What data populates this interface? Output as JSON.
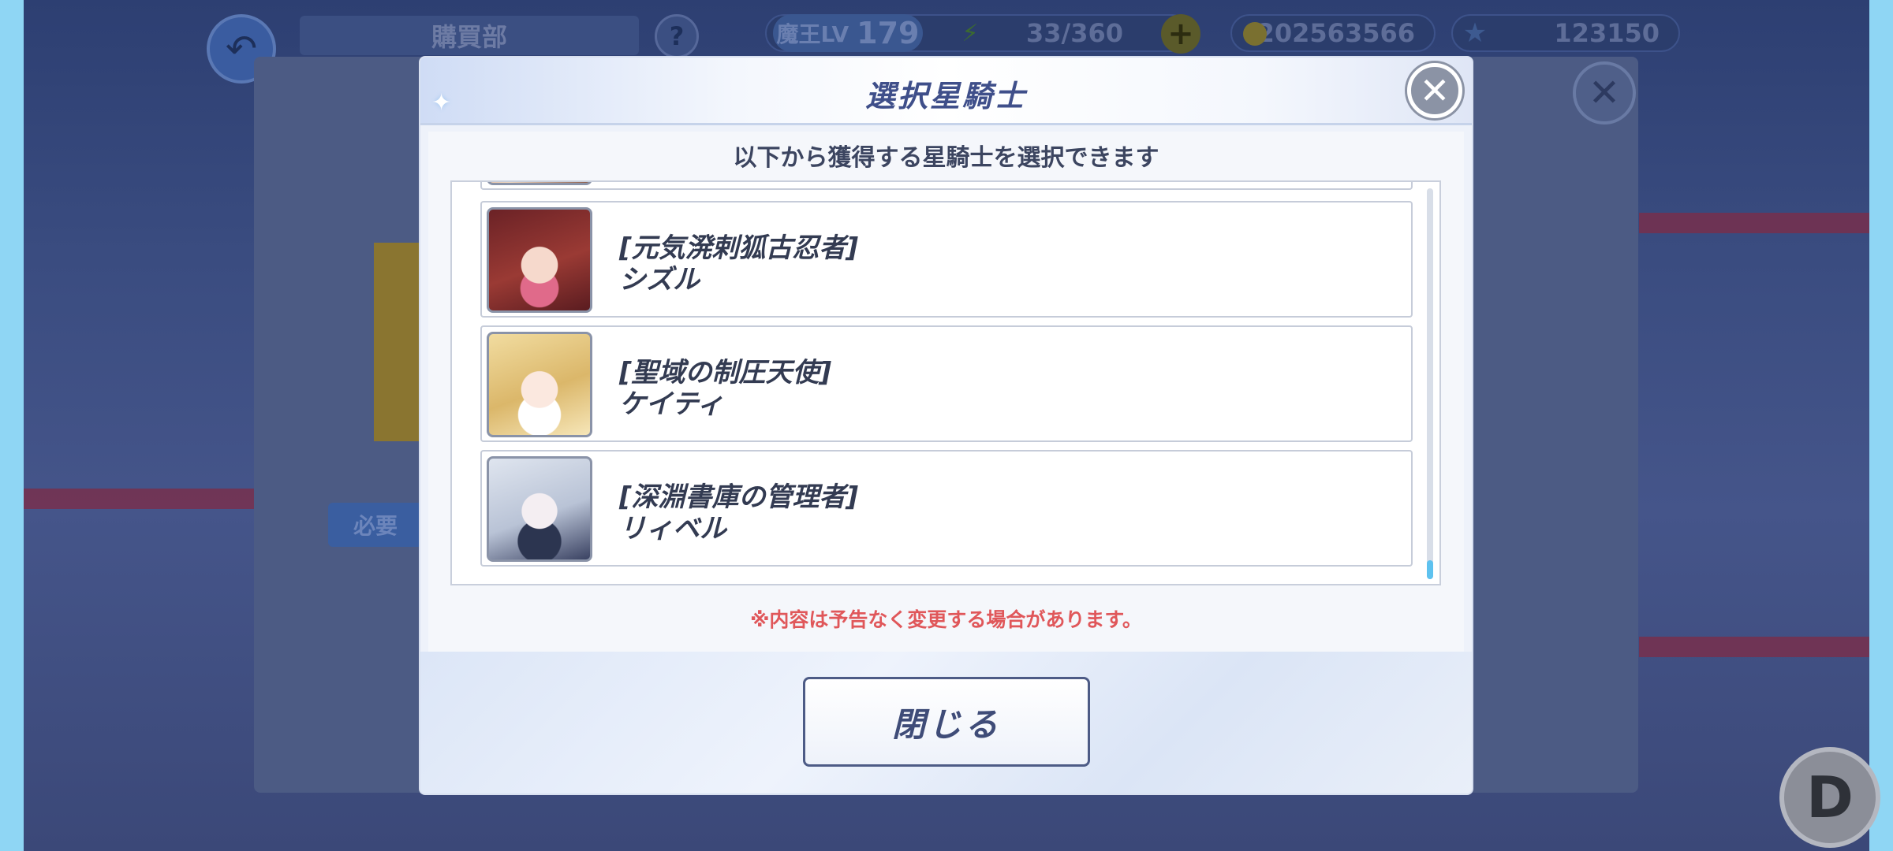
{
  "header": {
    "back_icon": "back-arrow-icon",
    "shop_title": "購買部",
    "help_label": "?",
    "level_label": "魔王LV",
    "level_value": "179",
    "stamina": "33/360",
    "coins": "202563566",
    "stars": "123150"
  },
  "background": {
    "need_label": "必要",
    "badge_letter": "D"
  },
  "modal": {
    "title": "選択星騎士",
    "subtitle": "以下から獲得する星騎士を選択できます",
    "notice": "※内容は予告なく変更する場合があります。",
    "close_button_label": "閉じる",
    "items": [
      {
        "title": "[元気溌剌狐古忍者]",
        "name": "シズル",
        "colors": [
          "#7a2a2e",
          "#f2d2c8",
          "#e06a8a"
        ]
      },
      {
        "title": "[聖域の制圧天使]",
        "name": "ケイティ",
        "colors": [
          "#e8cf8a",
          "#fbeecf",
          "#c8a25a"
        ]
      },
      {
        "title": "[深淵書庫の管理者]",
        "name": "リィベル",
        "colors": [
          "#cfd7e6",
          "#2c3550",
          "#6fb8c8"
        ]
      }
    ]
  },
  "colors": {
    "accent": "#3f4f8a",
    "notice": "#e0575a",
    "scroll": "#5ec2ef"
  }
}
